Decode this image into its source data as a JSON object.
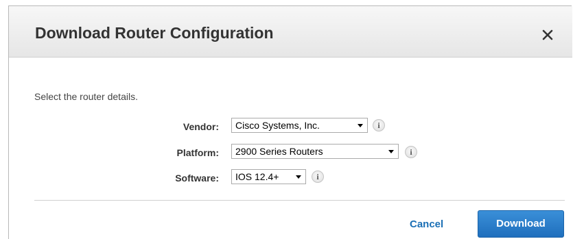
{
  "dialog": {
    "title": "Download Router Configuration",
    "close_icon": "close-icon",
    "intro": "Select the router details.",
    "fields": {
      "vendor": {
        "label": "Vendor:",
        "value": "Cisco Systems, Inc.",
        "info_icon": "i"
      },
      "platform": {
        "label": "Platform:",
        "value": "2900 Series Routers",
        "info_icon": "i"
      },
      "software": {
        "label": "Software:",
        "value": "IOS 12.4+",
        "info_icon": "i"
      }
    },
    "buttons": {
      "cancel": "Cancel",
      "download": "Download"
    }
  },
  "colors": {
    "accent": "#1f6fbd",
    "link": "#1a6fb5",
    "header_bg": "#eeeeee"
  }
}
